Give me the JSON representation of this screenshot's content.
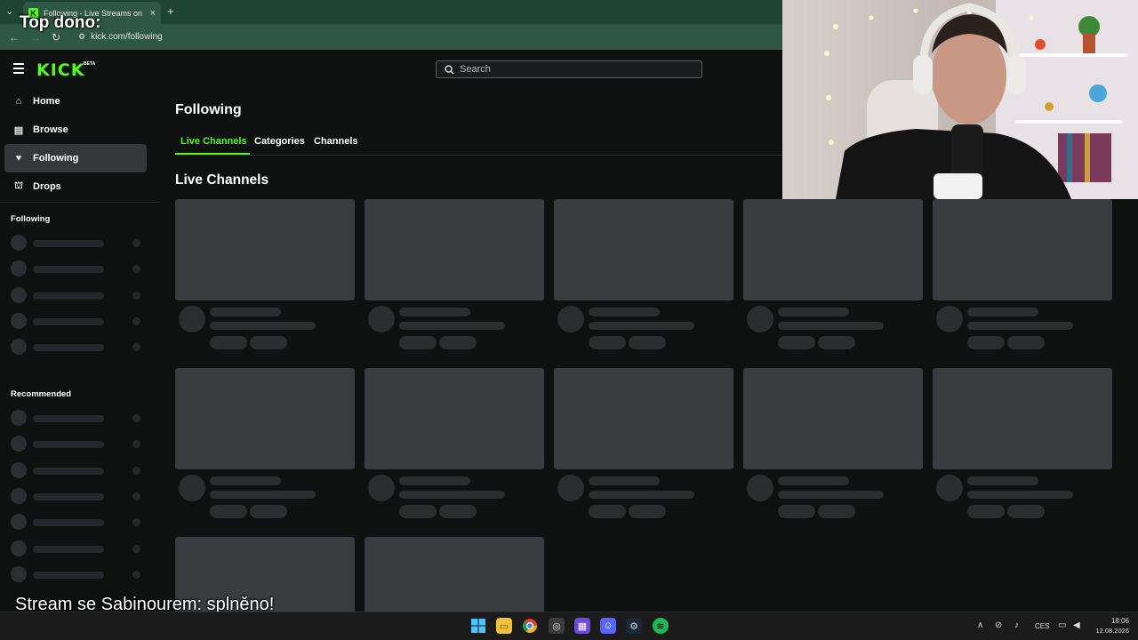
{
  "browser": {
    "tab_title": "Following - Live Streams on Kick",
    "url": "kick.com/following",
    "favicon_letter": "K"
  },
  "overlay": {
    "top_dono": "Top dono:",
    "goal_text": "Stream se Sabinourem: splněno!"
  },
  "header": {
    "logo": "KICK",
    "logo_badge": "BETA",
    "search_placeholder": "Search"
  },
  "sidebar": {
    "items": [
      {
        "label": "Home",
        "icon": "home-icon"
      },
      {
        "label": "Browse",
        "icon": "browse-icon"
      },
      {
        "label": "Following",
        "icon": "heart-icon",
        "active": true
      },
      {
        "label": "Drops",
        "icon": "drops-icon"
      }
    ],
    "following_heading": "Following",
    "recommended_heading": "Recommended"
  },
  "main": {
    "title": "Following",
    "tabs": [
      {
        "label": "Live Channels",
        "active": true
      },
      {
        "label": "Categories"
      },
      {
        "label": "Channels"
      }
    ],
    "section_title": "Live Channels"
  },
  "taskbar": {
    "time": "18:06",
    "date": "12.08.2026",
    "language": "CES"
  },
  "colors": {
    "accent": "#53fc18",
    "background": "#0f1010",
    "browser_chrome": "#2f5746"
  }
}
